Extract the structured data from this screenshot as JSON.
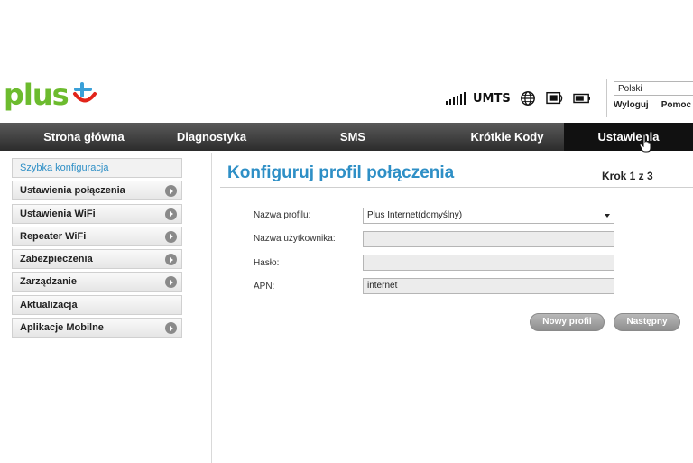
{
  "brand": {
    "logo_text": "plus"
  },
  "status": {
    "network": "UMTS"
  },
  "header": {
    "language": "Polski",
    "logout": "Wyloguj",
    "help": "Pomoc"
  },
  "nav": {
    "items": [
      {
        "label": "Strona główna"
      },
      {
        "label": "Diagnostyka"
      },
      {
        "label": "SMS"
      },
      {
        "label": "Krótkie Kody"
      },
      {
        "label": "Ustawienia",
        "active": true
      }
    ]
  },
  "sidebar": {
    "items": [
      {
        "label": "Szybka konfiguracja",
        "active": true
      },
      {
        "label": "Ustawienia połączenia"
      },
      {
        "label": "Ustawienia WiFi"
      },
      {
        "label": "Repeater WiFi"
      },
      {
        "label": "Zabezpieczenia"
      },
      {
        "label": "Zarządzanie"
      },
      {
        "label": "Aktualizacja"
      },
      {
        "label": "Aplikacje Mobilne"
      }
    ]
  },
  "main": {
    "title": "Konfiguruj profil połączenia",
    "step": "Krok 1 z 3",
    "fields": {
      "profile": {
        "label": "Nazwa profilu:",
        "value": "Plus Internet(domyślny)"
      },
      "username": {
        "label": "Nazwa użytkownika:",
        "value": ""
      },
      "password": {
        "label": "Hasło:",
        "value": ""
      },
      "apn": {
        "label": "APN:",
        "value": "internet"
      }
    },
    "buttons": {
      "new_profile": "Nowy profil",
      "next": "Następny"
    }
  },
  "colors": {
    "brand_green": "#6cbb2e",
    "brand_red": "#e2241a",
    "accent_blue": "#2e8fc6",
    "nav_dark": "#2c2c2c"
  }
}
